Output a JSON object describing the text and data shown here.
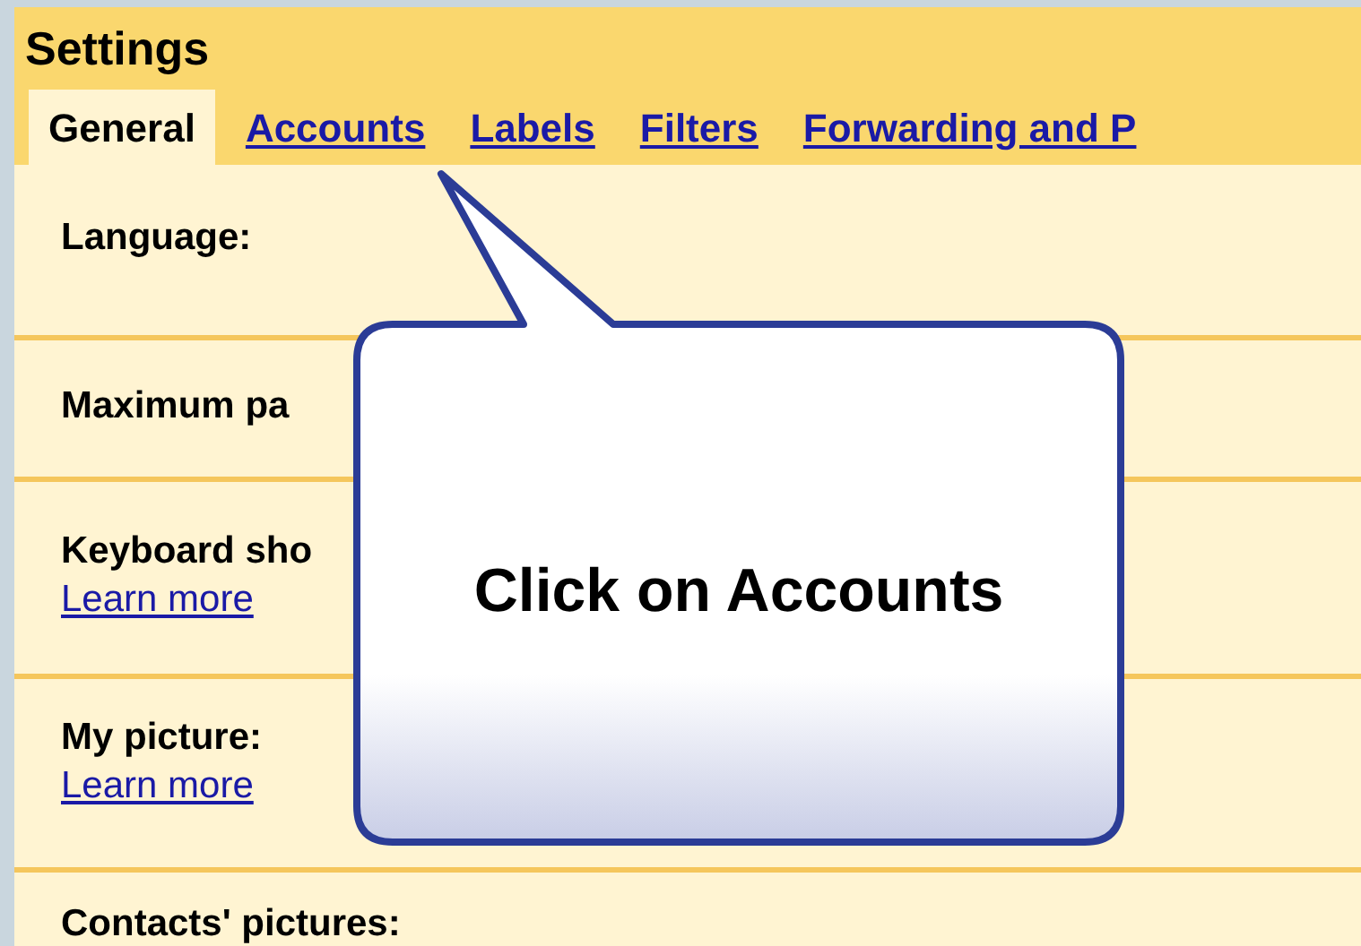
{
  "window": {
    "title": "Settings"
  },
  "tabs": [
    {
      "label": "General",
      "selected": true
    },
    {
      "label": "Accounts",
      "selected": false
    },
    {
      "label": "Labels",
      "selected": false
    },
    {
      "label": "Filters",
      "selected": false
    },
    {
      "label": "Forwarding and P",
      "selected": false
    }
  ],
  "rows": [
    {
      "label": "Language:"
    },
    {
      "label": "Maximum pa"
    },
    {
      "label": "Keyboard sho",
      "link": "Learn more"
    },
    {
      "label": "My picture:",
      "link": "Learn more"
    },
    {
      "label": "Contacts' pictures:"
    }
  ],
  "callout": {
    "text": "Click on Accounts"
  }
}
